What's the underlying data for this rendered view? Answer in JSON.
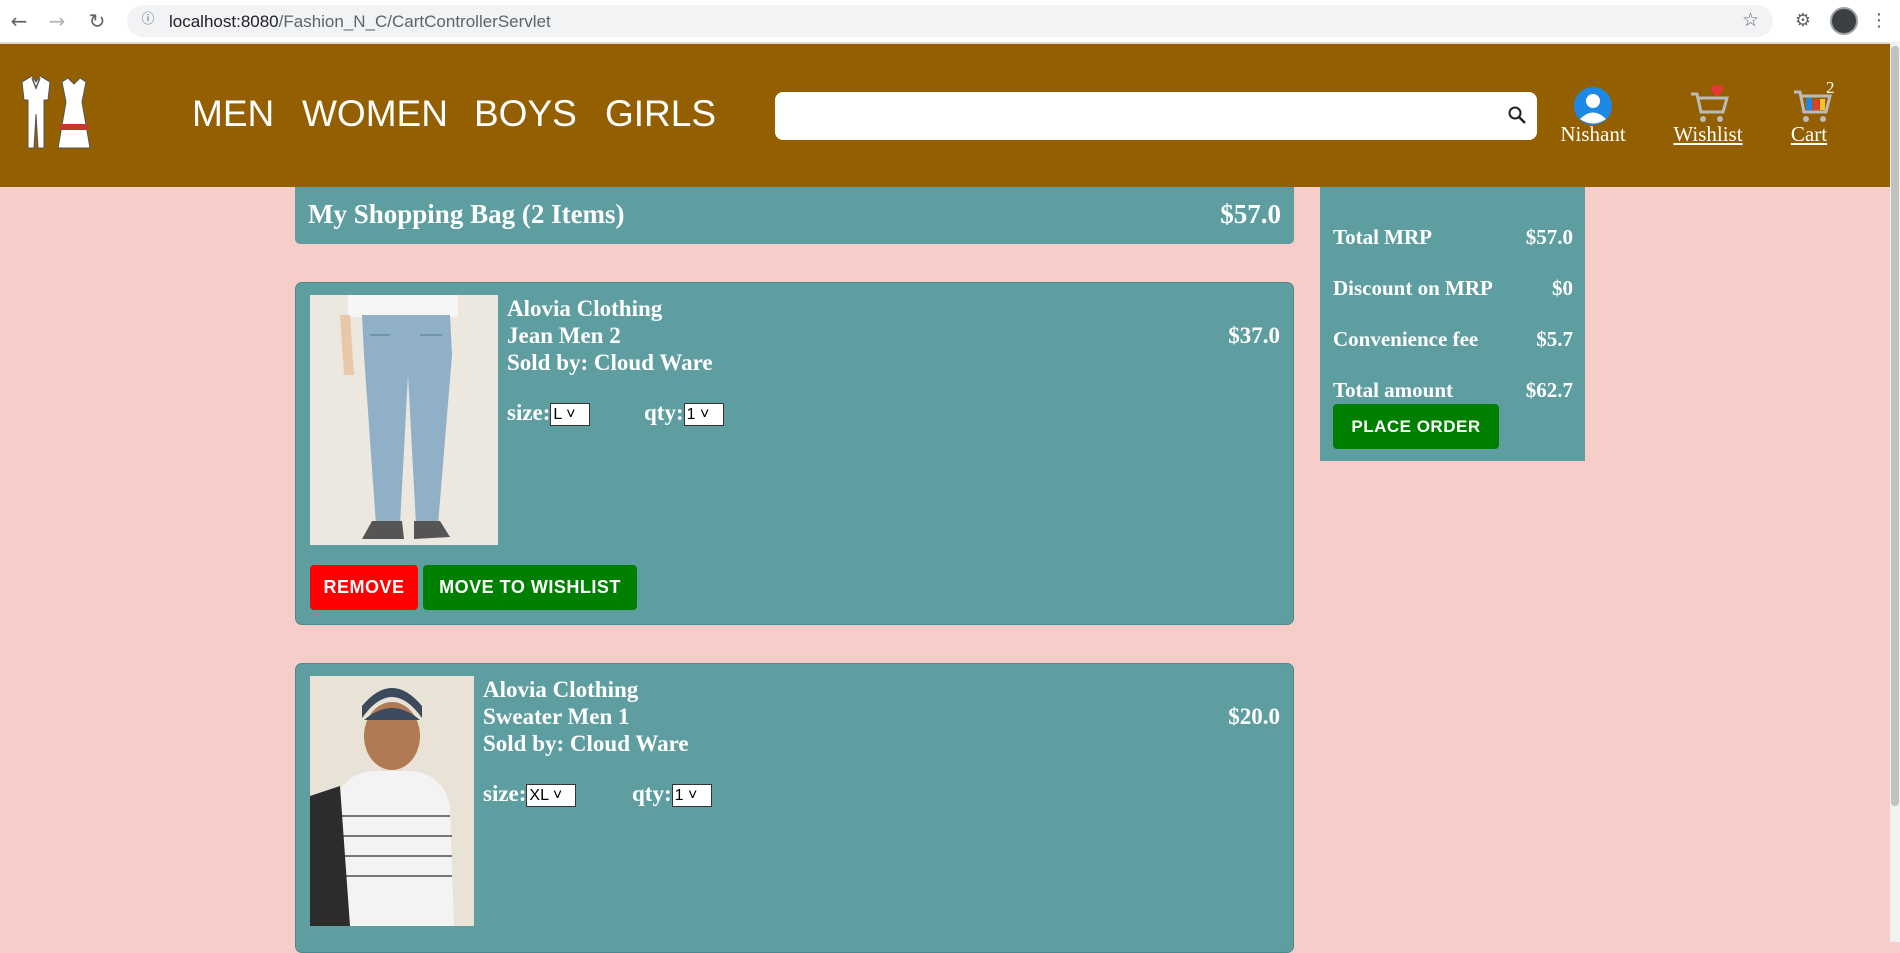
{
  "browser": {
    "url_host": "localhost:8080",
    "url_path": "/Fashion_N_C/CartControllerServlet"
  },
  "header": {
    "categories": [
      "MEN",
      "WOMEN",
      "BOYS",
      "GIRLS"
    ],
    "search_placeholder": "",
    "user_label": "Nishant",
    "wishlist_label": "Wishlist",
    "cart_label": "Cart",
    "cart_count": "2"
  },
  "bag": {
    "title": "My Shopping Bag (2 Items)",
    "total": "$57.0"
  },
  "items": [
    {
      "brand": "Alovia Clothing",
      "name": "Jean Men 2",
      "seller": "Sold by: Cloud Ware",
      "price": "$37.0",
      "size_label": "size:",
      "size": "L",
      "qty_label": "qty:",
      "qty": "1",
      "remove_label": "REMOVE",
      "wishlist_label": "MOVE TO WISHLIST"
    },
    {
      "brand": "Alovia Clothing",
      "name": "Sweater Men 1",
      "seller": "Sold by: Cloud Ware",
      "price": "$20.0",
      "size_label": "size:",
      "size": "XL",
      "qty_label": "qty:",
      "qty": "1"
    }
  ],
  "summary": {
    "rows": [
      {
        "label": "Total MRP",
        "value": "$57.0"
      },
      {
        "label": "Discount on MRP",
        "value": "$0"
      },
      {
        "label": "Convenience fee",
        "value": "$5.7"
      },
      {
        "label": "Total amount",
        "value": "$62.7"
      }
    ],
    "place_order_label": "PLACE ORDER"
  },
  "colors": {
    "header_bg": "#935f00",
    "page_bg": "#f7cdc9",
    "panel_bg": "#5f9ea0",
    "remove_btn": "#ff0000",
    "action_btn": "#008000"
  }
}
